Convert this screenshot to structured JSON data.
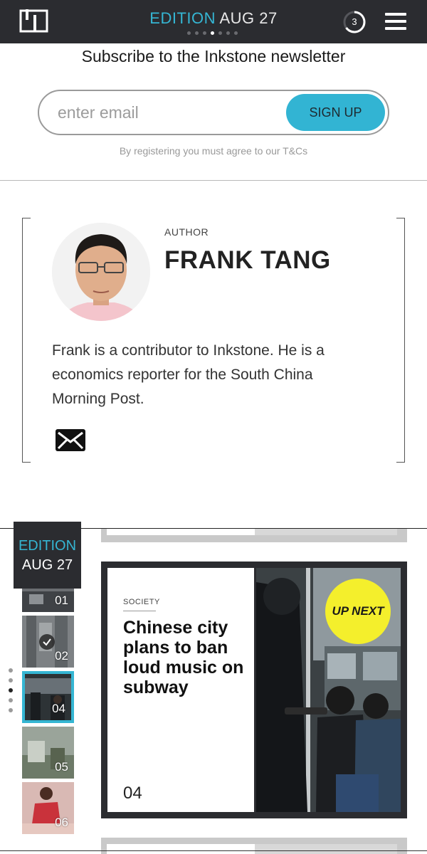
{
  "header": {
    "edition_label": "EDITION",
    "edition_date": "AUG 27",
    "page_dots": 7,
    "active_dot": 4,
    "reading_count": "3",
    "colors": {
      "bar": "#2b2c30",
      "accent": "#35b6d3"
    }
  },
  "newsletter": {
    "title": "Subscribe to the Inkstone newsletter",
    "email_placeholder": "enter email",
    "signup_label": "SIGN UP",
    "terms": "By registering you must agree to our T&Cs"
  },
  "author": {
    "label": "AUTHOR",
    "name": "FRANK TANG",
    "bio": "Frank is a contributor to Inkstone. He is a economics reporter for the South China Morning Post.",
    "contact_icon": "mail-icon"
  },
  "edition": {
    "badge_label": "EDITION",
    "badge_date": "AUG 27",
    "thumbnails": [
      {
        "num": "01",
        "selected": false
      },
      {
        "num": "02",
        "selected": false,
        "read": true
      },
      {
        "num": "04",
        "selected": true
      },
      {
        "num": "05",
        "selected": false
      },
      {
        "num": "06",
        "selected": false
      }
    ],
    "nav_dots": 5,
    "active_nav_dot": 3
  },
  "story_card": {
    "category": "SOCIETY",
    "title": "Chinese city plans to ban loud music on subway",
    "number": "04",
    "badge": "UP NEXT",
    "badge_color": "#f4ef2c"
  }
}
